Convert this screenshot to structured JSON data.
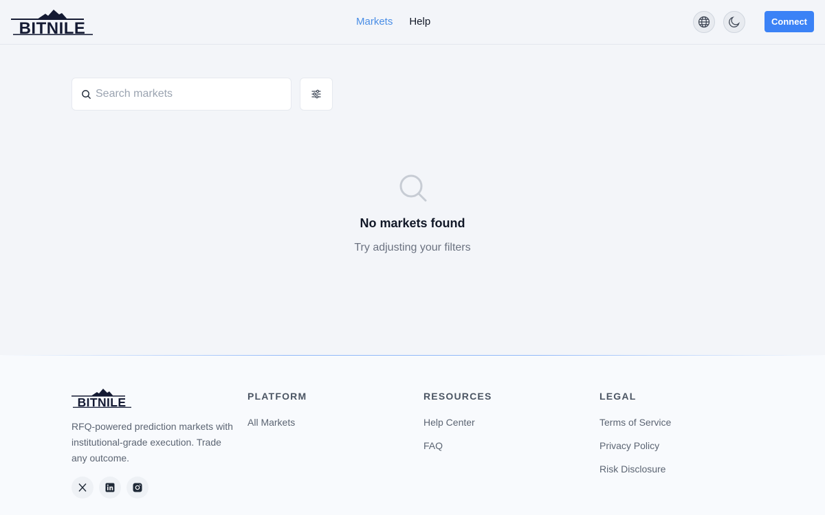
{
  "brand": {
    "name": "BITNILE"
  },
  "nav": {
    "items": [
      {
        "label": "Markets",
        "active": true
      },
      {
        "label": "Help",
        "active": false
      }
    ]
  },
  "header": {
    "globe_icon": "globe-icon",
    "theme_icon": "moon-icon",
    "connect_label": "Connect"
  },
  "search": {
    "placeholder": "Search markets",
    "value": "",
    "icon": "search-icon",
    "filter_icon": "sliders-icon"
  },
  "empty_state": {
    "icon": "search-icon",
    "title": "No markets found",
    "subtitle": "Try adjusting your filters"
  },
  "footer": {
    "description": "RFQ-powered prediction markets with institutional-grade execution. Trade any outcome.",
    "social": [
      "x-icon",
      "linkedin-icon",
      "instagram-icon"
    ],
    "columns": [
      {
        "heading": "PLATFORM",
        "links": [
          "All Markets"
        ]
      },
      {
        "heading": "RESOURCES",
        "links": [
          "Help Center",
          "FAQ"
        ]
      },
      {
        "heading": "LEGAL",
        "links": [
          "Terms of Service",
          "Privacy Policy",
          "Risk Disclosure"
        ]
      }
    ]
  },
  "colors": {
    "accent": "#3b82f6",
    "nav_active": "#4a8ee6",
    "background": "#f3f5f9",
    "text": "#111827",
    "muted": "#6b7280"
  }
}
